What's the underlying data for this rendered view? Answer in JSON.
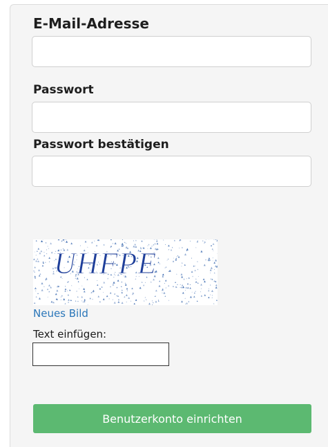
{
  "form": {
    "email_label": "E-Mail-Adresse",
    "email_value": "",
    "password_label": "Passwort",
    "password_value": "",
    "confirm_label": "Passwort bestätigen",
    "confirm_value": ""
  },
  "captcha": {
    "text": "UHFPE",
    "new_image_link": "Neues Bild",
    "input_label": "Text einfügen:",
    "input_value": ""
  },
  "submit": {
    "label": "Benutzerkonto einrichten",
    "color": "#5cb971"
  },
  "colors": {
    "link": "#2a76b9",
    "captcha_text": "#1f3f9a",
    "captcha_dots": "#3d6bb0"
  }
}
